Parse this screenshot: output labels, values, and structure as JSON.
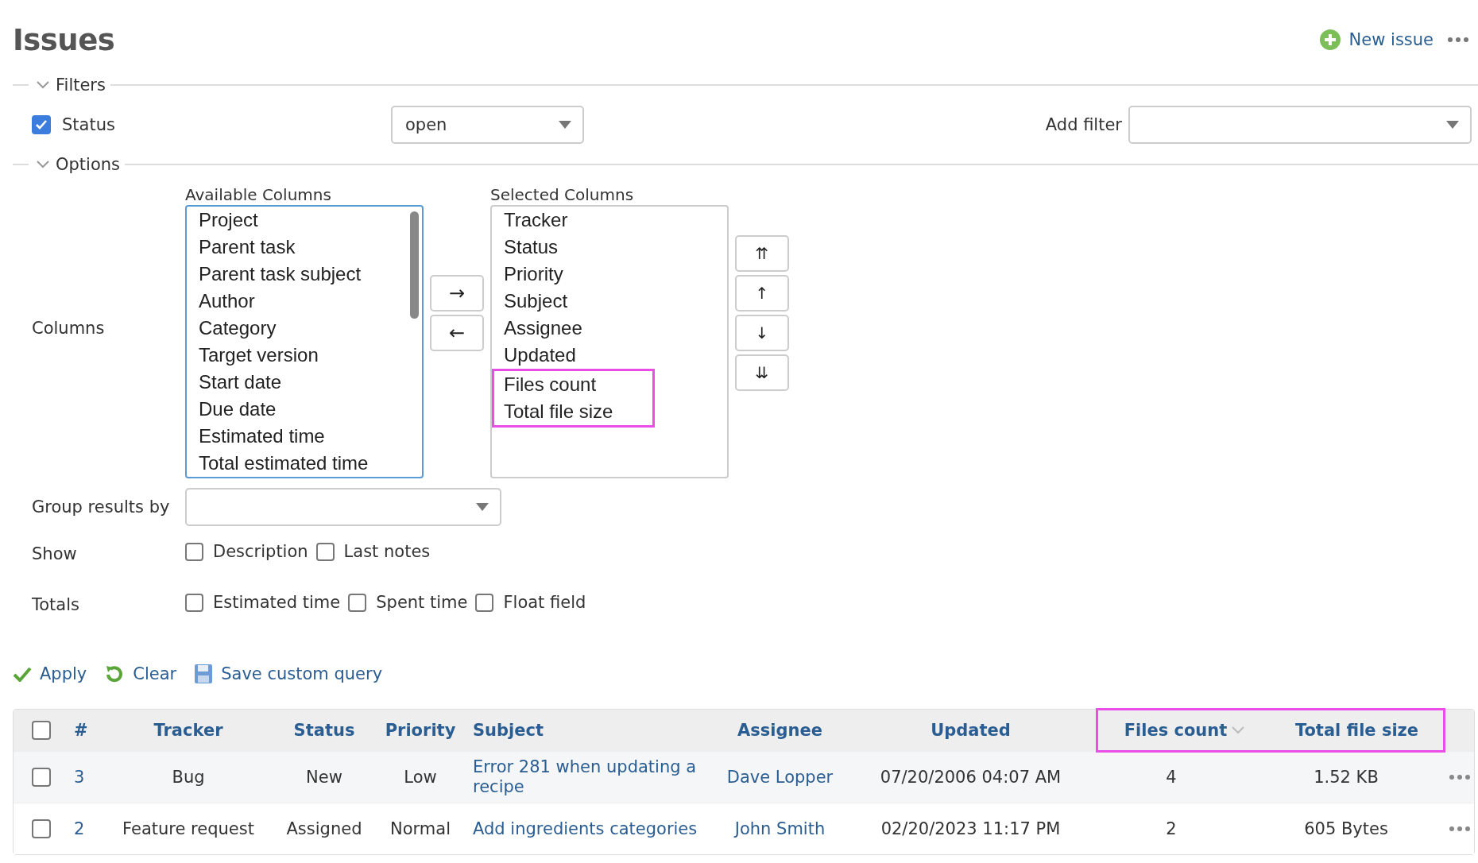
{
  "title": "Issues",
  "actions": {
    "new_issue": "New issue"
  },
  "filters": {
    "legend": "Filters",
    "expanded": true,
    "status": {
      "label": "Status",
      "checked": true,
      "value": "open"
    },
    "add_filter": {
      "label": "Add filter"
    }
  },
  "options": {
    "legend": "Options",
    "expanded": true,
    "columns_label": "Columns",
    "available": {
      "label": "Available Columns",
      "items": [
        {
          "label": "Project",
          "highlighted": false
        },
        {
          "label": "Parent task",
          "highlighted": false
        },
        {
          "label": "Parent task subject",
          "highlighted": false
        },
        {
          "label": "Author",
          "highlighted": false
        },
        {
          "label": "Category",
          "highlighted": false
        },
        {
          "label": "Target version",
          "highlighted": false
        },
        {
          "label": "Start date",
          "highlighted": false
        },
        {
          "label": "Due date",
          "highlighted": false
        },
        {
          "label": "Estimated time",
          "highlighted": false
        },
        {
          "label": "Total estimated time",
          "highlighted": false
        }
      ]
    },
    "transfer_buttons": [
      "→",
      "←"
    ],
    "selected": {
      "label": "Selected Columns",
      "items": [
        {
          "label": "Tracker",
          "highlighted": false
        },
        {
          "label": "Status",
          "highlighted": false
        },
        {
          "label": "Priority",
          "highlighted": false
        },
        {
          "label": "Subject",
          "highlighted": false
        },
        {
          "label": "Assignee",
          "highlighted": false
        },
        {
          "label": "Updated",
          "highlighted": false
        },
        {
          "label": "Files count",
          "highlighted": true
        },
        {
          "label": "Total file size",
          "highlighted": true
        }
      ]
    },
    "order_buttons": [
      "⇈",
      "↑",
      "↓",
      "⇊"
    ],
    "group_by": {
      "label": "Group results by"
    },
    "show": {
      "label": "Show",
      "items": [
        {
          "label": "Description",
          "checked": false
        },
        {
          "label": "Last notes",
          "checked": false
        }
      ]
    },
    "totals": {
      "label": "Totals",
      "items": [
        {
          "label": "Estimated time",
          "checked": false
        },
        {
          "label": "Spent time",
          "checked": false
        },
        {
          "label": "Float field",
          "checked": false
        }
      ]
    }
  },
  "query_actions": [
    {
      "kind": "apply",
      "label": "Apply"
    },
    {
      "kind": "clear",
      "label": "Clear"
    },
    {
      "kind": "save",
      "label": "Save custom query"
    }
  ],
  "table": {
    "all_checked": false,
    "columns": [
      {
        "label": "#",
        "link": true,
        "highlighted": false,
        "sorted": false
      },
      {
        "label": "Tracker",
        "link": false,
        "highlighted": false,
        "sorted": false
      },
      {
        "label": "Status",
        "link": false,
        "highlighted": false,
        "sorted": false
      },
      {
        "label": "Priority",
        "link": false,
        "highlighted": false,
        "sorted": false
      },
      {
        "label": "Subject",
        "link": true,
        "highlighted": false,
        "sorted": false
      },
      {
        "label": "Assignee",
        "link": true,
        "highlighted": false,
        "sorted": false
      },
      {
        "label": "Updated",
        "link": false,
        "highlighted": false,
        "sorted": false
      },
      {
        "label": "Files count",
        "link": false,
        "highlighted": true,
        "sorted": true
      },
      {
        "label": "Total file size",
        "link": false,
        "highlighted": true,
        "sorted": false
      }
    ],
    "rows": [
      {
        "checked": false,
        "cells": [
          "3",
          "Bug",
          "New",
          "Low",
          "Error 281 when updating a recipe",
          "Dave Lopper",
          "07/20/2006 04:07 AM",
          "4",
          "1.52 KB"
        ]
      },
      {
        "checked": false,
        "cells": [
          "2",
          "Feature request",
          "Assigned",
          "Normal",
          "Add ingredients categories",
          "John Smith",
          "02/20/2023 11:17 PM",
          "2",
          "605 Bytes"
        ]
      }
    ]
  }
}
